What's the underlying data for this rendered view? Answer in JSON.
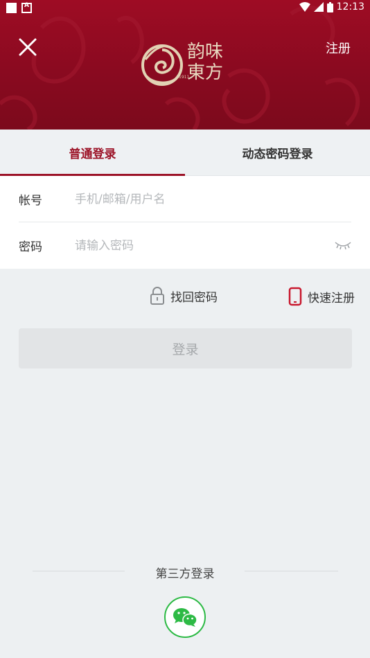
{
  "status_bar": {
    "time": "12:13"
  },
  "header": {
    "register_link": "注册",
    "logo_text_line1": "韵味",
    "logo_text_line2": "東方",
    "logo_sub": "1911"
  },
  "tabs": [
    {
      "label": "普通登录",
      "active": true
    },
    {
      "label": "动态密码登录",
      "active": false
    }
  ],
  "form": {
    "account_label": "帐号",
    "account_placeholder": "手机/邮箱/用户名",
    "password_label": "密码",
    "password_placeholder": "请输入密码"
  },
  "links": {
    "forgot_password": "找回密码",
    "quick_register": "快速注册"
  },
  "login_button": "登录",
  "third_party": {
    "label": "第三方登录"
  },
  "colors": {
    "brand": "#9c1327",
    "header_bg": "#8a0a20",
    "wechat": "#2dba45"
  }
}
